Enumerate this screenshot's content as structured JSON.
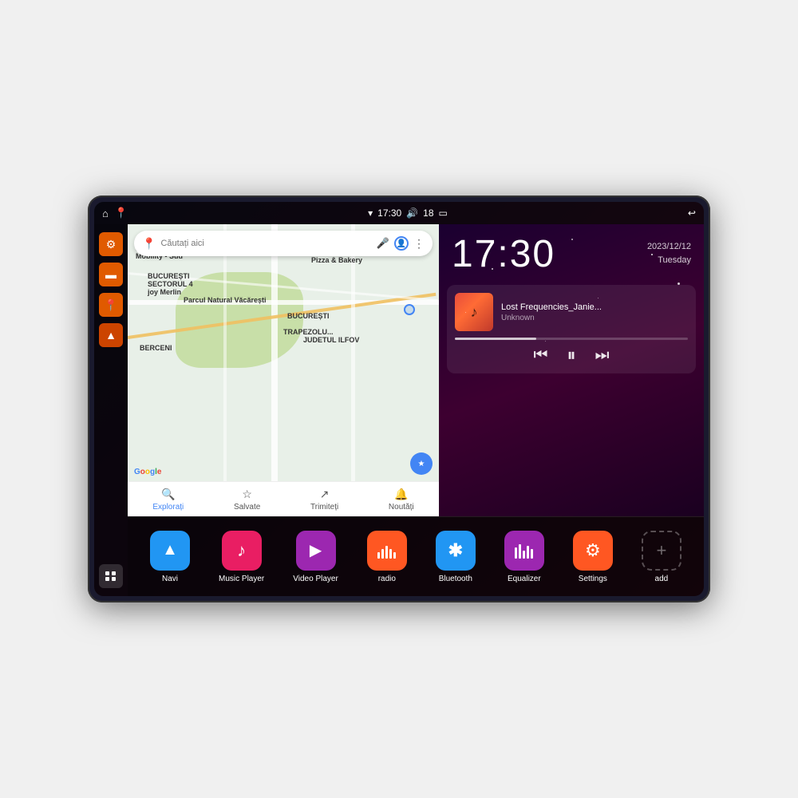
{
  "device": {
    "status_bar": {
      "home_icon": "⌂",
      "map_icon": "📍",
      "wifi_icon": "▾",
      "time": "17:30",
      "volume_icon": "🔊",
      "battery_level": "18",
      "battery_icon": "🔋",
      "back_icon": "↩"
    },
    "clock": {
      "time": "17:30",
      "date": "2023/12/12",
      "day": "Tuesday"
    },
    "music": {
      "track_name": "Lost Frequencies_Janie...",
      "artist": "Unknown",
      "progress": 35
    },
    "map": {
      "search_placeholder": "Căutați aici",
      "labels": [
        "Parcul Natural Văcărești",
        "BUCUREȘTI",
        "BUCUREȘTI SECTORUL 4",
        "JUDETUL ILFOV",
        "BERCENI",
        "Pizza & Bakery",
        "AXIS Premium Mobility - Sud",
        "joy Merlin"
      ],
      "bottom_items": [
        {
          "label": "Explorați",
          "icon": "🔍"
        },
        {
          "label": "Salvate",
          "icon": "☆"
        },
        {
          "label": "Trimiteți",
          "icon": "↗"
        },
        {
          "label": "Noutăți",
          "icon": "🔔"
        }
      ]
    },
    "apps": [
      {
        "id": "navi",
        "label": "Navi",
        "icon": "▲",
        "color": "#2196F3"
      },
      {
        "id": "music",
        "label": "Music Player",
        "icon": "♪",
        "color": "#E91E63"
      },
      {
        "id": "video",
        "label": "Video Player",
        "icon": "▶",
        "color": "#9C27B0"
      },
      {
        "id": "radio",
        "label": "radio",
        "icon": "📻",
        "color": "#FF5722"
      },
      {
        "id": "bluetooth",
        "label": "Bluetooth",
        "icon": "⚡",
        "color": "#2196F3"
      },
      {
        "id": "equalizer",
        "label": "Equalizer",
        "icon": "⧫",
        "color": "#9C27B0"
      },
      {
        "id": "settings",
        "label": "Settings",
        "icon": "⚙",
        "color": "#FF5722"
      },
      {
        "id": "add",
        "label": "add",
        "icon": "+",
        "color": "transparent"
      }
    ],
    "sidebar": [
      {
        "id": "settings",
        "icon": "⚙"
      },
      {
        "id": "files",
        "icon": "▬"
      },
      {
        "id": "maps",
        "icon": "📍"
      },
      {
        "id": "navigate",
        "icon": "▲"
      }
    ]
  }
}
